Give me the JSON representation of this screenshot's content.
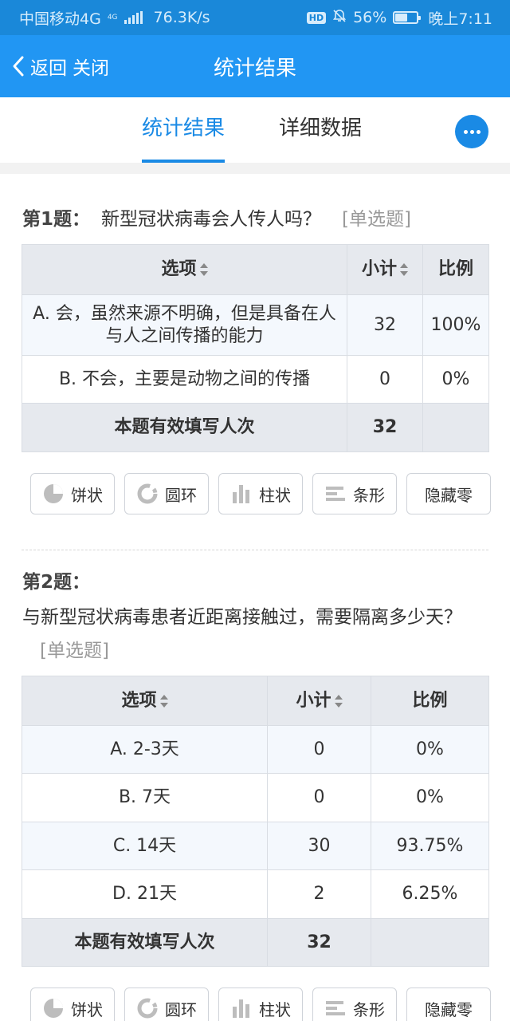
{
  "status_bar": {
    "carrier": "中国移动4G",
    "net_speed": "76.3K/s",
    "hd": "HD",
    "battery": "56%",
    "battery_level": 0.56,
    "time": "晚上7:11"
  },
  "nav": {
    "back_label": "返回",
    "close_label": "关闭",
    "title": "统计结果"
  },
  "tabs": {
    "stats": "统计结果",
    "detail": "详细数据"
  },
  "table_headers": {
    "option": "选项",
    "subtotal": "小计",
    "ratio": "比例"
  },
  "chart_buttons": {
    "pie": "饼状",
    "ring": "圆环",
    "column": "柱状",
    "bar": "条形",
    "hide_zero": "隐藏零"
  },
  "questions": [
    {
      "number": "第1题：",
      "text": "新型冠状病毒会人传人吗？",
      "type": "[单选题]",
      "rows": [
        {
          "option": "A. 会，虽然来源不明确，但是具备在人与人之间传播的能力",
          "count": "32",
          "ratio": "100%"
        },
        {
          "option": "B. 不会，主要是动物之间的传播",
          "count": "0",
          "ratio": "0%"
        }
      ],
      "total_label": "本题有效填写人次",
      "total": "32"
    },
    {
      "number": "第2题：",
      "text": "与新型冠状病毒患者近距离接触过，需要隔离多少天？",
      "type": "[单选题]",
      "rows": [
        {
          "option": "A. 2-3天",
          "count": "0",
          "ratio": "0%"
        },
        {
          "option": "B. 7天",
          "count": "0",
          "ratio": "0%"
        },
        {
          "option": "C. 14天",
          "count": "30",
          "ratio": "93.75%"
        },
        {
          "option": "D. 21天",
          "count": "2",
          "ratio": "6.25%"
        }
      ],
      "total_label": "本题有效填写人次",
      "total": "32"
    }
  ],
  "colors": {
    "status_bar": "#1a88d9",
    "nav_bar": "#2196f3",
    "accent": "#1a8ae5"
  }
}
